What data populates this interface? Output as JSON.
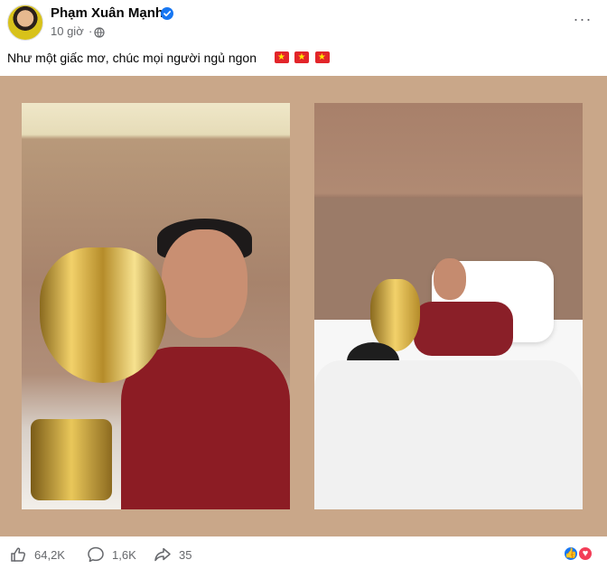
{
  "post": {
    "author": "Phạm Xuân Mạnh",
    "time": "10 giờ",
    "separator": "·",
    "more_label": "···",
    "caption": "Như một giấc mơ, chúc mọi người ngủ ngon",
    "flags_count": 3
  },
  "actions": {
    "likes": "64,2K",
    "comments": "1,6K",
    "shares": "35"
  },
  "colors": {
    "media_background": "#c9a789",
    "text_primary": "#050505",
    "text_secondary": "#65676b",
    "verified_blue": "#1877f2",
    "flag_red": "#e2252a",
    "flag_star": "#ffe600"
  },
  "icons": {
    "verified": "verified-badge-icon",
    "privacy": "globe-icon",
    "more": "more-options-icon",
    "like": "thumbs-up-icon",
    "comment": "comment-bubble-icon",
    "share": "share-arrow-icon",
    "reaction_like": "like-reaction-icon",
    "reaction_love": "love-reaction-icon"
  }
}
